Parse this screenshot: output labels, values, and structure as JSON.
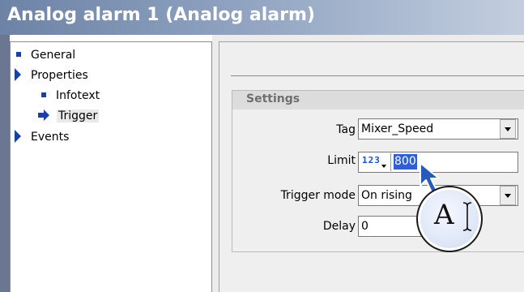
{
  "window": {
    "title": "Analog alarm 1 (Analog alarm)"
  },
  "nav": {
    "items": [
      {
        "label": "General",
        "icon": "square-bullet-icon",
        "level": 0
      },
      {
        "label": "Properties",
        "icon": "expand-triangle-icon",
        "level": 0
      },
      {
        "label": "Infotext",
        "icon": "square-bullet-icon",
        "level": 1
      },
      {
        "label": "Trigger",
        "icon": "arrow-right-icon",
        "level": 1,
        "selected": true
      },
      {
        "label": "Events",
        "icon": "expand-triangle-icon",
        "level": 0
      }
    ]
  },
  "settings": {
    "title": "Settings",
    "tag": {
      "label": "Tag",
      "value": "Mixer_Speed"
    },
    "limit": {
      "label": "Limit",
      "type_badge": "123",
      "value": "800"
    },
    "trigger_mode": {
      "label": "Trigger mode",
      "value": "On rising"
    },
    "delay": {
      "label": "Delay",
      "value": "0"
    }
  },
  "cursor": {
    "letter": "A",
    "icon": "text-cursor-magnifier-icon"
  },
  "colors": {
    "title_gradient_start": "#6d83a6",
    "title_gradient_end": "#c3cedf",
    "nav_icon": "#1c3fa3",
    "selection": "#2f5fd1",
    "badge_digits": "#1a4fd0"
  }
}
